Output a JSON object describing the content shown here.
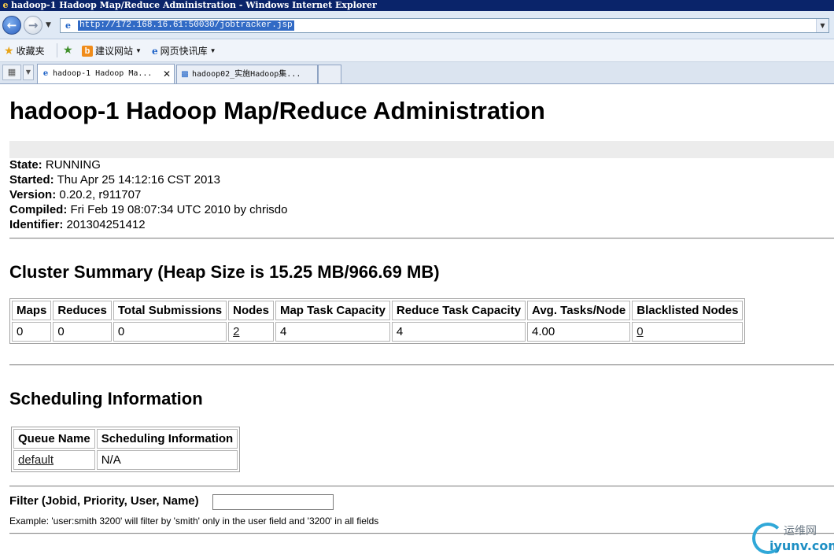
{
  "window": {
    "title": "hadoop-1 Hadoop Map/Reduce Administration - Windows Internet Explorer"
  },
  "address_bar": {
    "url": "http://172.168.16.61:50030/jobtracker.jsp"
  },
  "favorites_bar": {
    "favorites_label": "收藏夹",
    "suggested_sites": "建议网站",
    "web_slice": "网页快讯库"
  },
  "tabs": [
    {
      "label": "hadoop-1 Hadoop Ma...",
      "active": true
    },
    {
      "label": "hadoop02_实施Hadoop集...",
      "active": false
    }
  ],
  "page": {
    "title": "hadoop-1 Hadoop Map/Reduce Administration",
    "info": [
      {
        "label": "State:",
        "value": "RUNNING"
      },
      {
        "label": "Started:",
        "value": "Thu Apr 25 14:12:16 CST 2013"
      },
      {
        "label": "Version:",
        "value": "0.20.2, r911707"
      },
      {
        "label": "Compiled:",
        "value": "Fri Feb 19 08:07:34 UTC 2010 by chrisdo"
      },
      {
        "label": "Identifier:",
        "value": "201304251412"
      }
    ],
    "cluster_summary": {
      "heading": "Cluster Summary (Heap Size is 15.25 MB/966.69 MB)",
      "headers": [
        "Maps",
        "Reduces",
        "Total Submissions",
        "Nodes",
        "Map Task Capacity",
        "Reduce Task Capacity",
        "Avg. Tasks/Node",
        "Blacklisted Nodes"
      ],
      "values": [
        "0",
        "0",
        "0",
        "2",
        "4",
        "4",
        "4.00",
        "0"
      ]
    },
    "scheduling": {
      "heading": "Scheduling Information",
      "headers": [
        "Queue Name",
        "Scheduling Information"
      ],
      "rows": [
        [
          "default",
          "N/A"
        ]
      ]
    },
    "filter": {
      "label": "Filter (Jobid, Priority, User, Name)",
      "value": "",
      "example": "Example: 'user:smith 3200' will filter by 'smith' only in the user field and '3200' in all fields"
    }
  },
  "watermark": {
    "cn": "运维网",
    "en": "iyunv.com"
  }
}
